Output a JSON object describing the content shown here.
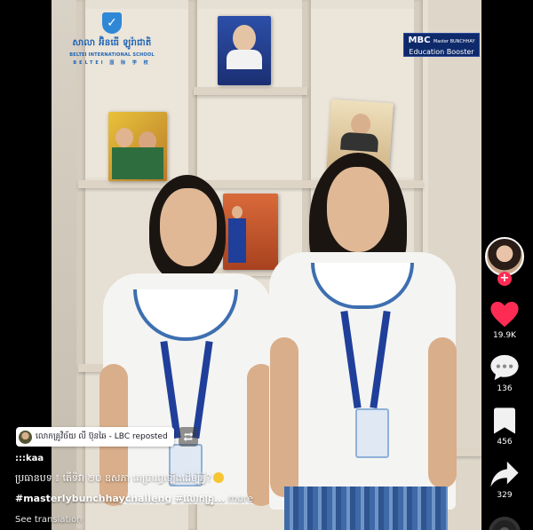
{
  "school_logo": {
    "khmer": "សាលា អ៊ិនធើ ឡូរ៉ាជាតិ",
    "english": "BELTEI INTERNATIONAL SCHOOL",
    "english_sub": "BELTEI 国 际 学 校"
  },
  "brand_logo": {
    "title": "MBC",
    "tag": "Master BUNCHHAY",
    "subtitle": "Education Booster"
  },
  "actions": {
    "likes": "19.9K",
    "comments": "136",
    "saves": "456",
    "shares": "329"
  },
  "repost": {
    "text": "លោកគ្រូវិច័យ លី ប៊ុនឆៃ - LBC reposted"
  },
  "caption": {
    "username": ":::kaa",
    "text": "ប្រធានបទ ៖ តើទិវា ២០ ឧសភា គេប្រារព្ធឡើងដើម្បីអ្វី?",
    "hashtags": "#masterlybunchhaychalleng #លោកគ្រូ...",
    "more": "more",
    "see_translation": "See translation"
  },
  "colors": {
    "like": "#fe2c55",
    "uniform_trim": "#3d6fb0",
    "brand_bg": "#0e2a6b"
  },
  "icons": [
    "heart-icon",
    "comment-icon",
    "bookmark-icon",
    "share-icon",
    "repost-icon",
    "plus-icon"
  ]
}
